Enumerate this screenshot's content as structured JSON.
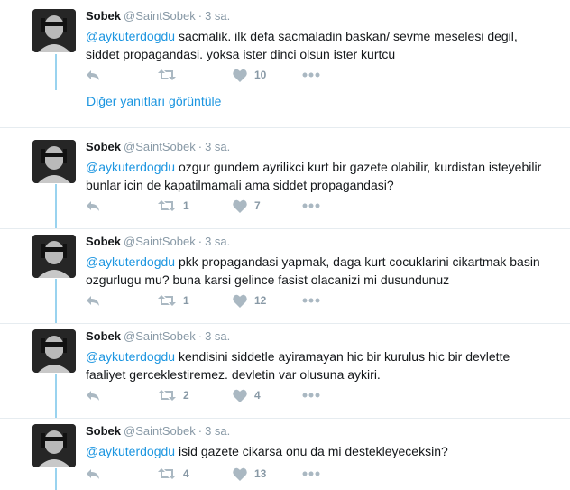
{
  "more_replies_label": "Diğer yanıtları görüntüle",
  "tweets": [
    {
      "name": "Sobek",
      "handle": "@SaintSobek",
      "sep": "·",
      "time": "3 sa.",
      "mention": "@aykuterdogdu",
      "text": " sacmalik. ilk defa sacmaladin baskan/ sevme meselesi degil, siddet propagandasi. yoksa ister dinci olsun ister kurtcu",
      "retweets": "",
      "likes": "10"
    },
    {
      "name": "Sobek",
      "handle": "@SaintSobek",
      "sep": "·",
      "time": "3 sa.",
      "mention": "@aykuterdogdu",
      "text": " ozgur gundem ayrilikci kurt bir gazete olabilir, kurdistan isteyebilir bunlar icin de kapatilmamali ama siddet propagandasi?",
      "retweets": "1",
      "likes": "7"
    },
    {
      "name": "Sobek",
      "handle": "@SaintSobek",
      "sep": "·",
      "time": "3 sa.",
      "mention": "@aykuterdogdu",
      "text": " pkk propagandasi yapmak, daga kurt cocuklarini cikartmak basin ozgurlugu mu? buna karsi gelince fasist olacanizi mi dusundunuz",
      "retweets": "1",
      "likes": "12"
    },
    {
      "name": "Sobek",
      "handle": "@SaintSobek",
      "sep": "·",
      "time": "3 sa.",
      "mention": "@aykuterdogdu",
      "text": " kendisini siddetle ayiramayan hic bir kurulus hic bir devlette faaliyet gerceklestiremez. devletin var olusuna aykiri.",
      "retweets": "2",
      "likes": "4"
    },
    {
      "name": "Sobek",
      "handle": "@SaintSobek",
      "sep": "·",
      "time": "3 sa.",
      "mention": "@aykuterdogdu",
      "text": " isid gazete cikarsa onu da mi destekleyeceksin?",
      "retweets": "4",
      "likes": "13"
    }
  ],
  "icons": {
    "reply": "reply-icon",
    "retweet": "retweet-icon",
    "like": "heart-icon",
    "more": "more-dots-icon"
  },
  "colors": {
    "link": "#1b95e0",
    "icon": "#aab8c2",
    "thread_line": "#99d3ef",
    "meta": "#8899a6"
  }
}
